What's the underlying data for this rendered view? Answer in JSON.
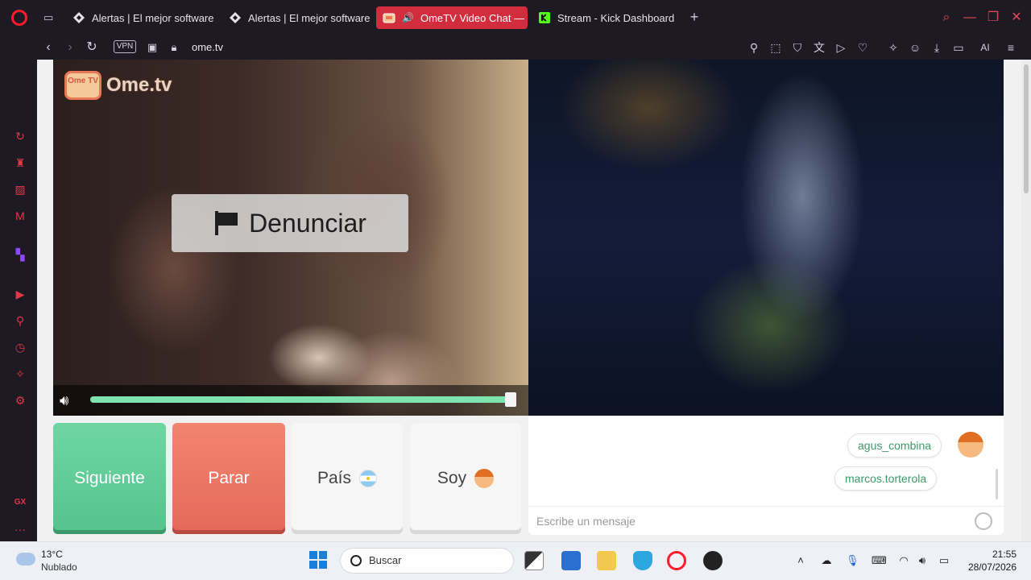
{
  "browser": {
    "tabs": [
      {
        "title": "Alertas | El mejor software p",
        "active": false,
        "icon": "streamlabs-icon"
      },
      {
        "title": "Alertas | El mejor software p",
        "active": false,
        "icon": "streamlabs-icon"
      },
      {
        "title": "OmeTV Video Chat — C",
        "active": true,
        "icon": "ometv-icon"
      },
      {
        "title": "Stream - Kick Dashboard",
        "active": false,
        "icon": "kick-icon"
      }
    ],
    "vpn_label": "VPN",
    "url": "ome.tv",
    "ai_label": "AI",
    "sidebar_gx_label": "GX",
    "sidebar_more": "···"
  },
  "ometv": {
    "logo_badge": "Ome TV",
    "logo_text": "Ome.tv",
    "report_label": "Denunciar",
    "volume_percent": 100,
    "buttons": {
      "next": "Siguiente",
      "stop": "Parar",
      "country": "País",
      "iam": "Soy"
    },
    "chat": {
      "messages": [
        {
          "text": "agus_combina",
          "avatar": true
        },
        {
          "text": "marcos.torterola",
          "avatar": false
        }
      ],
      "input_placeholder": "Escribe un mensaje"
    }
  },
  "taskbar": {
    "weather_temp": "13°C",
    "weather_desc": "Nublado",
    "search_label": "Buscar",
    "time": "21:55",
    "date": "28/07/2026"
  }
}
